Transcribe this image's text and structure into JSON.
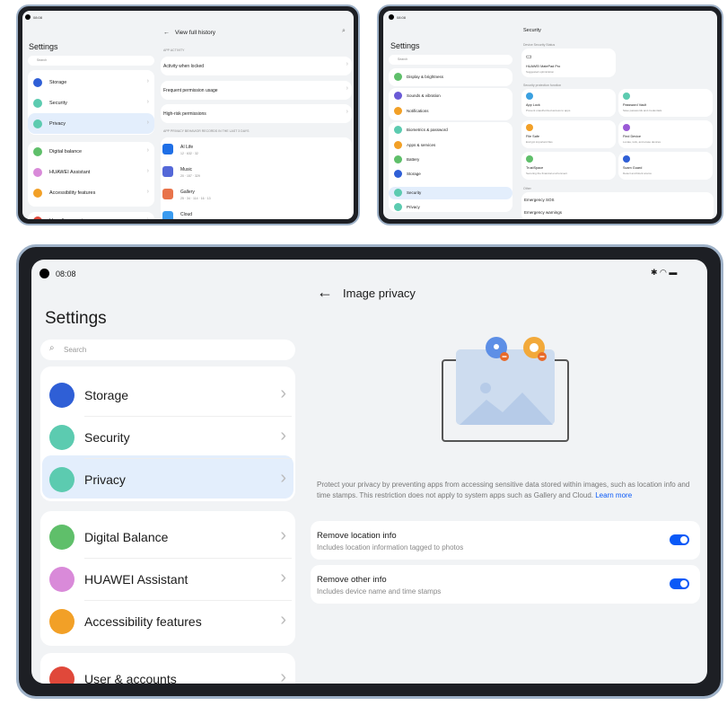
{
  "deviceA": {
    "time": "08:08",
    "settings_title": "Settings",
    "search_placeholder": "Search",
    "menu": [
      "Storage",
      "Security",
      "Privacy",
      "Digital balance",
      "HUAWEI Assistant",
      "Accessibility features",
      "User & accounts"
    ],
    "menu_colors": [
      "#2f5fd6",
      "#5ccbb0",
      "#5ccbb0",
      "#5fbf6a",
      "#d98ad9",
      "#f2a027",
      "#e0483a"
    ],
    "page_title": "View full history",
    "section1": "APP ACTIVITY",
    "rows": [
      "Activity when locked",
      "Frequent permission usage",
      "High-risk permissions"
    ],
    "section2": "APP PRIVACY BEHAVIOR RECORDS IN THE LAST 3 DAYS",
    "apps": [
      {
        "name": "AI Life",
        "stats": "12 · 632 · 32",
        "color": "#1f6fe6"
      },
      {
        "name": "Music",
        "stats": "20 · 157 · 329",
        "color": "#5468d8"
      },
      {
        "name": "Gallery",
        "stats": "25 · 34 · 114 · 16 · 13",
        "color": "#e8734a"
      },
      {
        "name": "Cloud",
        "stats": "63 · 102",
        "color": "#3a9bf0"
      }
    ]
  },
  "deviceB": {
    "time": "08:08",
    "settings_title": "Settings",
    "search_placeholder": "Search",
    "menu": [
      "Display & brightness",
      "Sounds & vibration",
      "Notifications",
      "Biometrics & password",
      "Apps & services",
      "Battery",
      "Storage",
      "Security",
      "Privacy"
    ],
    "menu_colors": [
      "#5fbf6a",
      "#6a5ad6",
      "#f2a027",
      "#5ccbb0",
      "#f2a027",
      "#5fbf6a",
      "#2f5fd6",
      "#5ccbb0",
      "#5ccbb0"
    ],
    "page_title": "Security",
    "status_label": "Device Security Status",
    "device_name": "HUAWEI MatePad Pro",
    "device_sub": "Suggested optimization",
    "protection_label": "Security protection function",
    "features": [
      {
        "name": "App Lock",
        "desc": "Prevent unauthorized access to apps",
        "color": "#3aa0e0"
      },
      {
        "name": "Password Vault",
        "desc": "Save passwords and credentials",
        "color": "#5ccbb0"
      },
      {
        "name": "File Safe",
        "desc": "Encrypt important files",
        "color": "#f2a027"
      },
      {
        "name": "Find Device",
        "desc": "Locate, lock, and erase devices",
        "color": "#9a5ad6"
      },
      {
        "name": "TrustSpace",
        "desc": "Securing the financial environment",
        "color": "#5fbf6a"
      },
      {
        "name": "Scam Guard",
        "desc": "Detect and block scams",
        "color": "#2f5fd6"
      }
    ],
    "other_label": "Other",
    "other_rows": [
      "Emergency SOS",
      "Emergency warnings"
    ]
  },
  "deviceC": {
    "time": "08:08",
    "settings_title": "Settings",
    "search_placeholder": "Search",
    "menu": [
      "Storage",
      "Security",
      "Privacy",
      "Digital Balance",
      "HUAWEI Assistant",
      "Accessibility features",
      "User & accounts"
    ],
    "menu_colors": [
      "#2f5fd6",
      "#5ccbb0",
      "#5ccbb0",
      "#5fbf6a",
      "#d98ad9",
      "#f2a027",
      "#e0483a"
    ],
    "page_title": "Image privacy",
    "description": "Protect your privacy by preventing apps from accessing sensitive data stored within images, such as location info and time stamps. This restriction does not apply to system apps such as Gallery and Cloud.",
    "learn_more": "Learn more",
    "toggles": [
      {
        "title": "Remove location info",
        "sub": "Includes location information tagged to photos",
        "on": true
      },
      {
        "title": "Remove other info",
        "sub": "Includes device name and time stamps",
        "on": true
      }
    ],
    "accent": "#0a59f7"
  }
}
